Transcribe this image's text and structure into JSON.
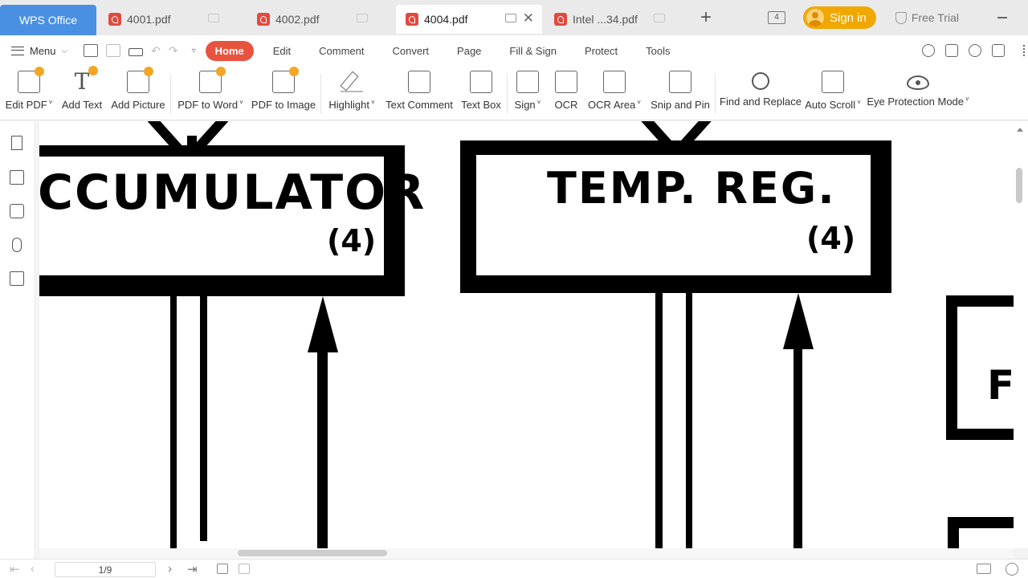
{
  "tabbar": {
    "app_tab": "WPS Office",
    "docs": [
      {
        "name": "4001.pdf",
        "active": false
      },
      {
        "name": "4002.pdf",
        "active": false
      },
      {
        "name": "4004.pdf",
        "active": true
      },
      {
        "name": "Intel ...34.pdf",
        "active": false
      }
    ],
    "monitor_count": "4",
    "sign_in": "Sign in",
    "free_trial": "Free Trial"
  },
  "menubar": {
    "menu_label": "Menu",
    "tabs": [
      "Home",
      "Edit",
      "Comment",
      "Convert",
      "Page",
      "Fill & Sign",
      "Protect",
      "Tools"
    ],
    "active_tab": "Home"
  },
  "ribbon": {
    "edit_pdf": "Edit PDF",
    "add_text": "Add Text",
    "add_picture": "Add Picture",
    "pdf_to_word": "PDF to Word",
    "pdf_to_image": "PDF to Image",
    "highlight": "Highlight",
    "text_comment": "Text Comment",
    "text_box": "Text Box",
    "sign": "Sign",
    "ocr": "OCR",
    "ocr_area": "OCR Area",
    "snip_and_pin": "Snip and Pin",
    "find_and_replace": "Find and Replace",
    "auto_scroll": "Auto Scroll",
    "eye_protection_mode": "Eye Protection Mode"
  },
  "document": {
    "left_box_label": "CCUMULATOR",
    "left_box_sub": "(4)",
    "right_box_label": "TEMP. REG.",
    "right_box_sub": "(4)",
    "partial_box_letter": "F"
  },
  "statusbar": {
    "page_indicator": "1/9"
  },
  "colors": {
    "accent": "#e8533f",
    "wps_blue": "#4a90e2",
    "sign_in": "#f0a800"
  }
}
